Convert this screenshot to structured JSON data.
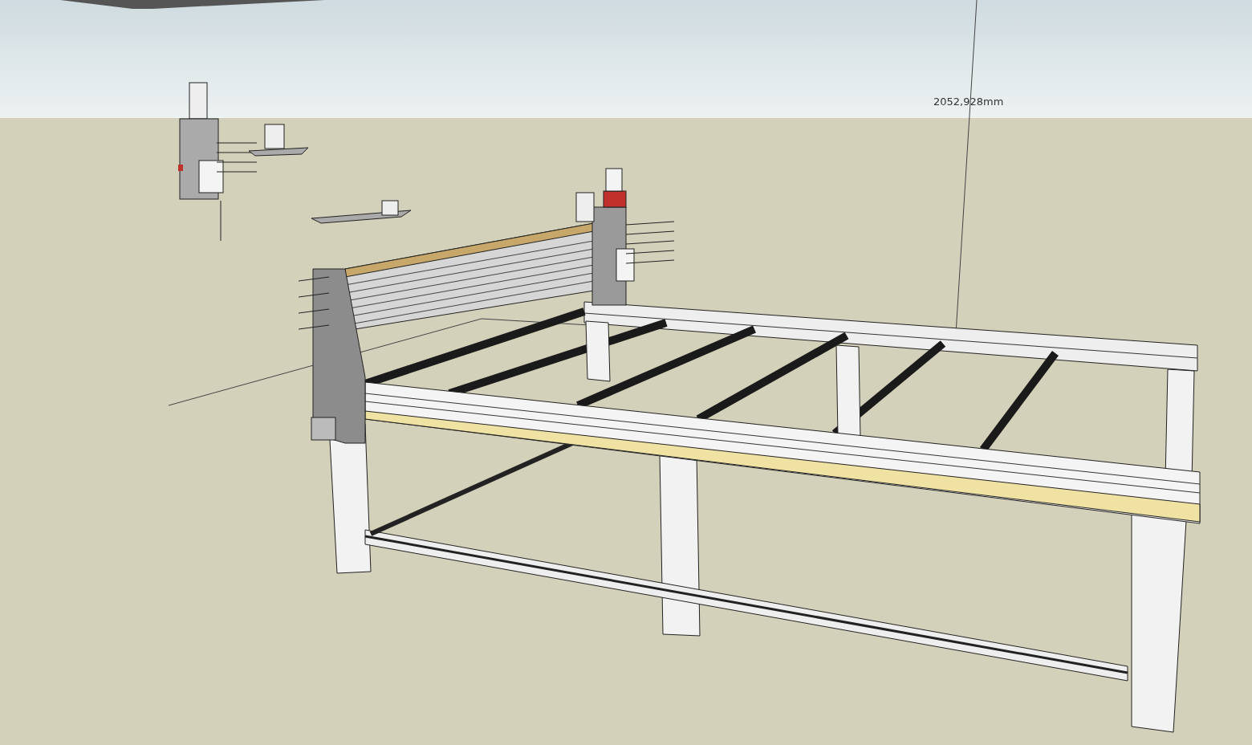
{
  "viewport": {
    "dimension_label": "2052,928mm"
  }
}
